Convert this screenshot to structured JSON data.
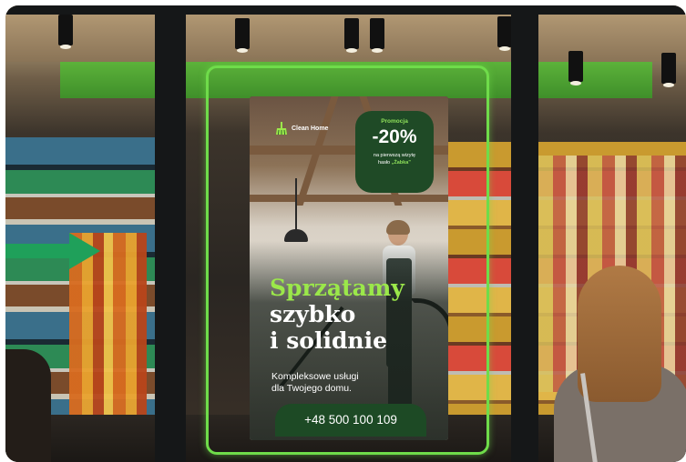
{
  "poster": {
    "brand": "Clean Home",
    "promo": {
      "label": "Promocja",
      "discount": "-20%",
      "note_line1": "na pierwszą wizytę",
      "note_prefix": "hasło",
      "code": "„Żabka”"
    },
    "headline_accent": "Sprzątamy",
    "headline_line2": "szybko",
    "headline_line3": "i solidnie",
    "subtext_line1": "Kompleksowe usługi",
    "subtext_line2": "dla Twojego domu.",
    "phone": "+48 500 100 109"
  },
  "colors": {
    "accent_green": "#6fdc4a",
    "headline_green": "#9be84a",
    "poster_dark_green": "#1d4a25",
    "arrow_green": "#1fa05a"
  },
  "icons": {
    "brand": "broom-icon",
    "pointer": "arrow-right-icon"
  }
}
